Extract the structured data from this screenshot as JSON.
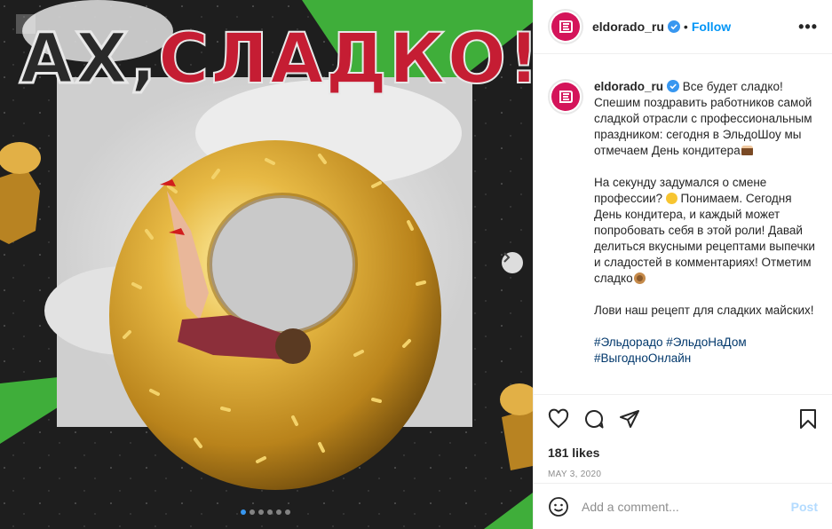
{
  "post": {
    "headline_word1": "АХ,",
    "headline_word2": "СЛАДКО!",
    "slide_count": 6,
    "active_slide": 1
  },
  "header": {
    "username": "eldorado_ru",
    "separator": "•",
    "follow_label": "Follow",
    "more_label": "•••"
  },
  "caption": {
    "username": "eldorado_ru",
    "p1": "Все будет сладко!\nСпешим поздравить работников самой сладкой отрасли с профессиональным праздником: сегодня в ЭльдоШоу мы отмечаем День кондитера",
    "p2a": "На секунду задумался о смене профессии? ",
    "p2b": " Понимаем. Сегодня День кондитера, и каждый может попробовать себя в этой роли! Давай делиться вкусными рецептами выпечки и сладостей в комментариях! Отметим сладко",
    "p3": "Лови наш рецепт для сладких майских!",
    "hashtags_line1": "#Эльдорадо #ЭльдоНаДом",
    "hashtags_line2": "#ВыгодноОнлайн"
  },
  "icons": {
    "like": "heart-icon",
    "comment": "comment-icon",
    "share": "paper-plane-icon",
    "save": "bookmark-icon",
    "emoji": "smiley-icon",
    "next": "chevron-right-icon"
  },
  "stats": {
    "likes": "181 likes",
    "date": "MAY 3, 2020"
  },
  "comment_box": {
    "placeholder": "Add a comment...",
    "post_label": "Post"
  },
  "colors": {
    "brand": "#d4145a",
    "accent_green": "#3fae3a",
    "link_blue": "#0095f6",
    "headline_red": "#c51d33"
  }
}
